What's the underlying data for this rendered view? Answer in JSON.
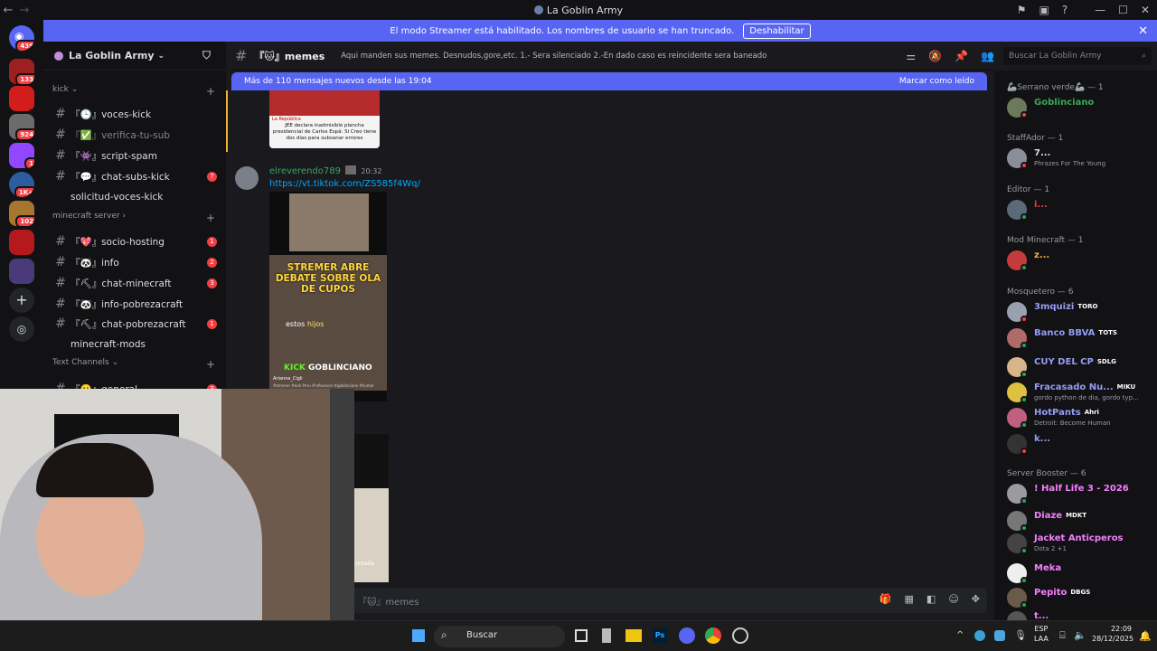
{
  "window": {
    "title": "La Goblin Army",
    "back": "←",
    "forward": "→"
  },
  "servers": [
    {
      "badge": "439"
    },
    {
      "badge": "133"
    },
    {
      "badge": ""
    },
    {
      "badge": "924"
    },
    {
      "badge": "1"
    },
    {
      "badge": "1K+"
    },
    {
      "badge": "102"
    },
    {
      "badge": ""
    },
    {
      "badge": ""
    }
  ],
  "banner": {
    "text": "El modo Streamer está habilitado. Los nombres de usuario se han truncado.",
    "button": "Deshabilitar"
  },
  "guild": {
    "name": "La Goblin Army"
  },
  "categories": {
    "kick": "kick",
    "minecraft": "minecraft server",
    "text": "Text Channels"
  },
  "channels": [
    {
      "label": "『🕒』voces-kick",
      "count": ""
    },
    {
      "label": "『✅』verifica-tu-sub",
      "count": ""
    },
    {
      "label": "『👾』script-spam",
      "count": ""
    },
    {
      "label": "『💬』chat-subs-kick",
      "count": "7"
    },
    {
      "label": "solicitud-voces-kick",
      "count": ""
    },
    {
      "label": "『💖』socio-hosting",
      "count": "1"
    },
    {
      "label": "『🐼』info",
      "count": "2"
    },
    {
      "label": "『⛏』chat-minecraft",
      "count": "3"
    },
    {
      "label": "『🐼』info-pobrezacraft",
      "count": ""
    },
    {
      "label": "『⛏』chat-pobrezacraft",
      "count": "1"
    },
    {
      "label": "minecraft-mods",
      "count": ""
    },
    {
      "label": "『🙂』general",
      "count": "3"
    }
  ],
  "chat": {
    "channel": "『🐱』memes",
    "topic": "Aqui manden sus memes. Desnudos,gore,etc. 1.- Sera silenciado 2.-En dado caso es reincidente sera baneado",
    "search_placeholder": "Buscar La Goblin Army",
    "new_messages": "Más de 110 mensajes nuevos desde las 19:04",
    "mark_read": "Marcar como leído",
    "image1_caption": "JEE declara inadmisible plancha presidencial de Carlos Espá: Si Creo tiene dos días para subsanar errores",
    "image1_source": "La República",
    "message": {
      "author": "elreverendo789",
      "time": "20:32",
      "link": "https://vt.tiktok.com/ZS585f4Wq/"
    },
    "video": {
      "headline": "STREMER ABRE DEBATE SOBRE OLA DE CUPOS",
      "subtitle_a": "estos ",
      "subtitle_b": "hijos",
      "brand_a": "KICK",
      "brand_b": "GOBLINCIANO",
      "credit": "Arianna_Cigli",
      "footer": "#stremer #kick Peru #influencer #goblinciano #humor ...más"
    },
    "video2_caption": "contalla",
    "input_placeholder": "『🐱』memes"
  },
  "members": {
    "groups": [
      {
        "title": "🦾Serrano verde🦾 — 1",
        "members": [
          {
            "name": "Goblinciano",
            "color": "#3ba55d",
            "sub": "",
            "tag": "",
            "status": "#f23f43"
          }
        ]
      },
      {
        "title": "StaffAdor — 1",
        "members": [
          {
            "name": "7...",
            "color": "#dbdee1",
            "sub": "Phrazes For The Young",
            "tag": "",
            "status": "#f23f43"
          }
        ]
      },
      {
        "title": "Editor — 1",
        "members": [
          {
            "name": "i...",
            "color": "#f23f43",
            "sub": "",
            "tag": "",
            "status": "#23a55a"
          }
        ]
      },
      {
        "title": "Mod Minecraft — 1",
        "members": [
          {
            "name": "z...",
            "color": "#f0b232",
            "sub": "",
            "tag": "",
            "status": "#23a55a"
          }
        ]
      },
      {
        "title": "Mosquetero — 6",
        "members": [
          {
            "name": "3mquizi",
            "color": "#949cf7",
            "sub": "",
            "tag": "TORO",
            "status": "#f23f43"
          },
          {
            "name": "Banco BBVA",
            "color": "#949cf7",
            "sub": "",
            "tag": "TOTS",
            "status": "#23a55a"
          },
          {
            "name": "CUY DEL CP",
            "color": "#949cf7",
            "sub": "",
            "tag": "SDLG",
            "status": "#23a55a"
          },
          {
            "name": "Fracasado Nu...",
            "color": "#949cf7",
            "sub": "gordo python de dia, gordo typ...",
            "tag": "MIKU",
            "status": "#23a55a"
          },
          {
            "name": "HotPants",
            "color": "#949cf7",
            "sub": "Detroit: Become Human",
            "tag": "Ahri",
            "status": "#23a55a"
          },
          {
            "name": "k...",
            "color": "#949cf7",
            "sub": "",
            "tag": "",
            "status": "#f23f43"
          }
        ]
      },
      {
        "title": "Server Booster — 6",
        "members": [
          {
            "name": "! Half Life 3 - 2026",
            "color": "#f47fff",
            "sub": "",
            "tag": "",
            "status": "#23a55a"
          },
          {
            "name": "Diaze",
            "color": "#f47fff",
            "sub": "",
            "tag": "MDKT",
            "status": "#23a55a"
          },
          {
            "name": "Jacket Anticperos",
            "color": "#f47fff",
            "sub": "Dota 2 +1",
            "tag": "",
            "status": "#23a55a"
          },
          {
            "name": "Meka",
            "color": "#f47fff",
            "sub": "",
            "tag": "",
            "status": "#23a55a"
          },
          {
            "name": "Pepito",
            "color": "#f47fff",
            "sub": "",
            "tag": "DBGS",
            "status": "#23a55a"
          },
          {
            "name": "t...",
            "color": "#f47fff",
            "sub": "",
            "tag": "",
            "status": "#23a55a"
          }
        ]
      }
    ]
  },
  "taskbar": {
    "search": "Buscar",
    "lang": "ESP",
    "layout": "LAA",
    "time": "22:09",
    "date": "28/12/2025",
    "ps_label": "Ps"
  }
}
